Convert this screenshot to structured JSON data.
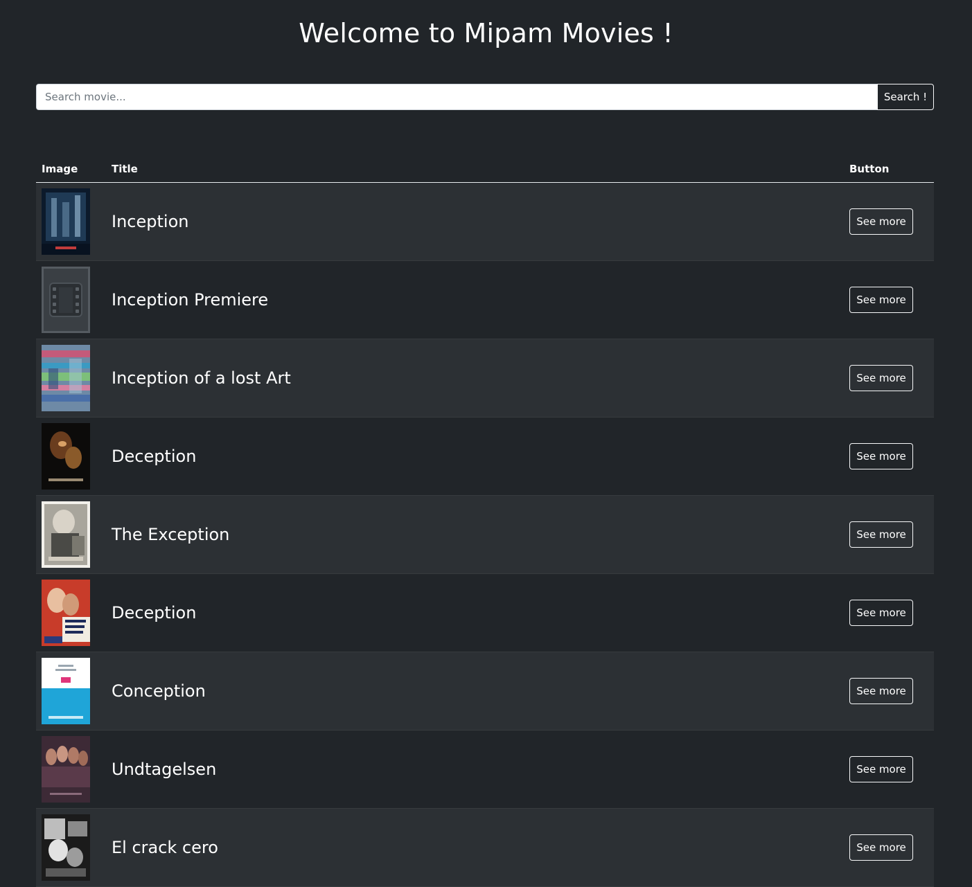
{
  "header": {
    "title": "Welcome to Mipam Movies !"
  },
  "search": {
    "placeholder": "Search movie...",
    "value": "",
    "button_label": "Search !"
  },
  "table": {
    "columns": [
      "Image",
      "Title",
      "Button"
    ],
    "rows": [
      {
        "title": "Inception",
        "button_label": "See more",
        "poster": "inception-poster"
      },
      {
        "title": "Inception Premiere",
        "button_label": "See more",
        "poster": "placeholder-film-icon"
      },
      {
        "title": "Inception of a lost Art",
        "button_label": "See more",
        "poster": "abstract-poster"
      },
      {
        "title": "Deception",
        "button_label": "See more",
        "poster": "deception-dark-poster"
      },
      {
        "title": "The Exception",
        "button_label": "See more",
        "poster": "exception-poster"
      },
      {
        "title": "Deception",
        "button_label": "See more",
        "poster": "deception-vintage-poster"
      },
      {
        "title": "Conception",
        "button_label": "See more",
        "poster": "conception-poster"
      },
      {
        "title": "Undtagelsen",
        "button_label": "See more",
        "poster": "undtagelsen-poster"
      },
      {
        "title": "El crack cero",
        "button_label": "See more",
        "poster": "el-crack-cero-poster"
      }
    ]
  },
  "colors": {
    "background": "#212529",
    "striped_row": "#2c3034",
    "text": "#ffffff"
  }
}
